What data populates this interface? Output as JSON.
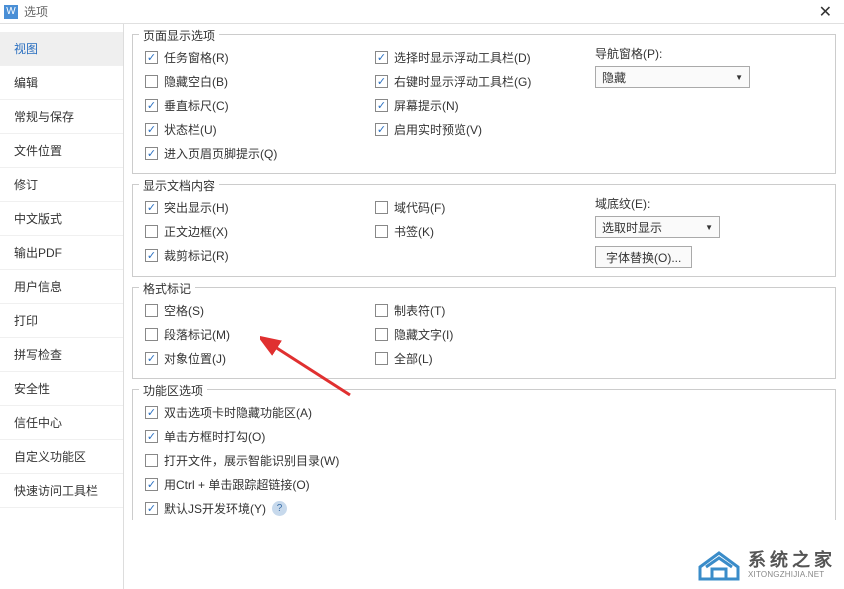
{
  "title": "选项",
  "sidebar": {
    "items": [
      {
        "label": "视图",
        "active": true
      },
      {
        "label": "编辑"
      },
      {
        "label": "常规与保存"
      },
      {
        "label": "文件位置"
      },
      {
        "label": "修订"
      },
      {
        "label": "中文版式"
      },
      {
        "label": "输出PDF"
      },
      {
        "label": "用户信息"
      },
      {
        "label": "打印"
      },
      {
        "label": "拼写检查"
      },
      {
        "label": "安全性"
      },
      {
        "label": "信任中心"
      },
      {
        "label": "自定义功能区"
      },
      {
        "label": "快速访问工具栏"
      }
    ]
  },
  "groups": {
    "page_display": {
      "title": "页面显示选项",
      "col1": [
        {
          "label": "任务窗格(R)",
          "checked": true
        },
        {
          "label": "隐藏空白(B)",
          "checked": false
        },
        {
          "label": "垂直标尺(C)",
          "checked": true
        },
        {
          "label": "状态栏(U)",
          "checked": true
        },
        {
          "label": "进入页眉页脚提示(Q)",
          "checked": true
        }
      ],
      "col2": [
        {
          "label": "选择时显示浮动工具栏(D)",
          "checked": true
        },
        {
          "label": "右键时显示浮动工具栏(G)",
          "checked": true
        },
        {
          "label": "屏幕提示(N)",
          "checked": true
        },
        {
          "label": "启用实时预览(V)",
          "checked": true
        }
      ],
      "nav_label": "导航窗格(P):",
      "nav_value": "隐藏"
    },
    "doc_content": {
      "title": "显示文档内容",
      "col1": [
        {
          "label": "突出显示(H)",
          "checked": true
        },
        {
          "label": "正文边框(X)",
          "checked": false
        },
        {
          "label": "裁剪标记(R)",
          "checked": true
        }
      ],
      "col2": [
        {
          "label": "域代码(F)",
          "checked": false
        },
        {
          "label": "书签(K)",
          "checked": false
        }
      ],
      "shade_label": "域底纹(E):",
      "shade_value": "选取时显示",
      "font_sub_btn": "字体替换(O)..."
    },
    "format_marks": {
      "title": "格式标记",
      "col1": [
        {
          "label": "空格(S)",
          "checked": false
        },
        {
          "label": "段落标记(M)",
          "checked": false
        },
        {
          "label": "对象位置(J)",
          "checked": true
        }
      ],
      "col2": [
        {
          "label": "制表符(T)",
          "checked": false
        },
        {
          "label": "隐藏文字(I)",
          "checked": false
        },
        {
          "label": "全部(L)",
          "checked": false
        }
      ]
    },
    "ribbon": {
      "title": "功能区选项",
      "items": [
        {
          "label": "双击选项卡时隐藏功能区(A)",
          "checked": true
        },
        {
          "label": "单击方框时打勾(O)",
          "checked": true
        },
        {
          "label": "打开文件，展示智能识别目录(W)",
          "checked": false
        },
        {
          "label": "用Ctrl + 单击跟踪超链接(O)",
          "checked": true
        },
        {
          "label": "默认JS开发环境(Y)",
          "checked": true,
          "help": true
        }
      ]
    }
  },
  "watermark": {
    "cn": "系统之家",
    "url": "XITONGZHIJIA.NET"
  }
}
